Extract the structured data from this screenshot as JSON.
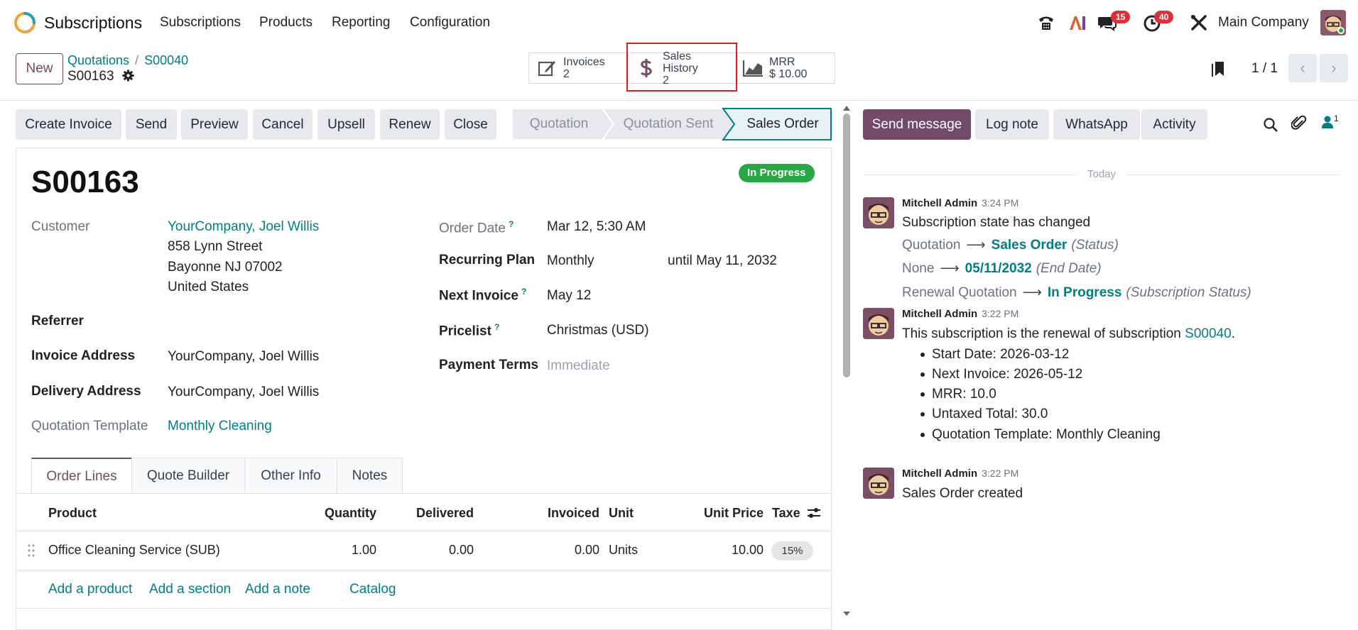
{
  "app": {
    "name": "Subscriptions"
  },
  "menu": {
    "items": [
      "Subscriptions",
      "Products",
      "Reporting",
      "Configuration"
    ]
  },
  "systray": {
    "messages_count": "15",
    "activities_count": "40",
    "company": "Main Company"
  },
  "control": {
    "new_label": "New",
    "breadcrumb": [
      "Quotations",
      "S00040"
    ],
    "record": "S00163",
    "smart_buttons": [
      {
        "label": "Invoices",
        "value": "2"
      },
      {
        "label": "Sales History",
        "value": "2"
      },
      {
        "label": "MRR",
        "value": "$ 10.00"
      }
    ],
    "pager": "1 / 1"
  },
  "actions": [
    "Create Invoice",
    "Send",
    "Preview",
    "Cancel",
    "Upsell",
    "Renew",
    "Close"
  ],
  "stages": [
    "Quotation",
    "Quotation Sent",
    "Sales Order"
  ],
  "form": {
    "name": "S00163",
    "status": "In Progress",
    "customer_label": "Customer",
    "customer": "YourCompany, Joel Willis",
    "address": [
      "858 Lynn Street",
      "Bayonne NJ 07002",
      "United States"
    ],
    "referrer_label": "Referrer",
    "invoice_address_label": "Invoice Address",
    "invoice_address": "YourCompany, Joel Willis",
    "delivery_address_label": "Delivery Address",
    "delivery_address": "YourCompany, Joel Willis",
    "template_label": "Quotation Template",
    "template": "Monthly Cleaning",
    "order_date_label": "Order Date",
    "order_date": "Mar 12, 5:30 AM",
    "plan_label": "Recurring Plan",
    "plan": "Monthly",
    "until": "until May 11, 2032",
    "next_invoice_label": "Next Invoice",
    "next_invoice": "May 12",
    "pricelist_label": "Pricelist",
    "pricelist": "Christmas (USD)",
    "payment_terms_label": "Payment Terms",
    "payment_terms": "Immediate"
  },
  "tabs": [
    "Order Lines",
    "Quote Builder",
    "Other Info",
    "Notes"
  ],
  "lines": {
    "headers": [
      "Product",
      "Quantity",
      "Delivered",
      "Invoiced",
      "Unit",
      "Unit Price",
      "Taxes"
    ],
    "rows": [
      {
        "product": "Office Cleaning Service (SUB)",
        "quantity": "1.00",
        "delivered": "0.00",
        "invoiced": "0.00",
        "unit": "Units",
        "price": "10.00",
        "tax": "15%"
      }
    ],
    "add_links": [
      "Add a product",
      "Add a section",
      "Add a note",
      "Catalog"
    ]
  },
  "chatter": {
    "buttons": [
      "Send message",
      "Log note",
      "WhatsApp",
      "Activity"
    ],
    "followers": "1",
    "today": "Today",
    "messages": [
      {
        "author": "Mitchell Admin",
        "time": "3:24 PM",
        "text": "Subscription state has changed",
        "tracking": [
          {
            "old": "Quotation",
            "new": "Sales Order",
            "field": "(Status)"
          },
          {
            "old": "None",
            "new": "05/11/2032",
            "field": "(End Date)"
          },
          {
            "old": "Renewal Quotation",
            "new": "In Progress",
            "field": "(Subscription Status)"
          }
        ]
      },
      {
        "author": "Mitchell Admin",
        "time": "3:22 PM",
        "text": "This subscription is the renewal of subscription",
        "link": "S00040",
        "bullets": [
          "Start Date: 2026-03-12",
          "Next Invoice: 2026-05-12",
          "MRR: 10.0",
          "Untaxed Total: 30.0",
          "Quotation Template: Monthly Cleaning"
        ]
      },
      {
        "author": "Mitchell Admin",
        "time": "3:22 PM",
        "text": "Sales Order created"
      }
    ]
  }
}
